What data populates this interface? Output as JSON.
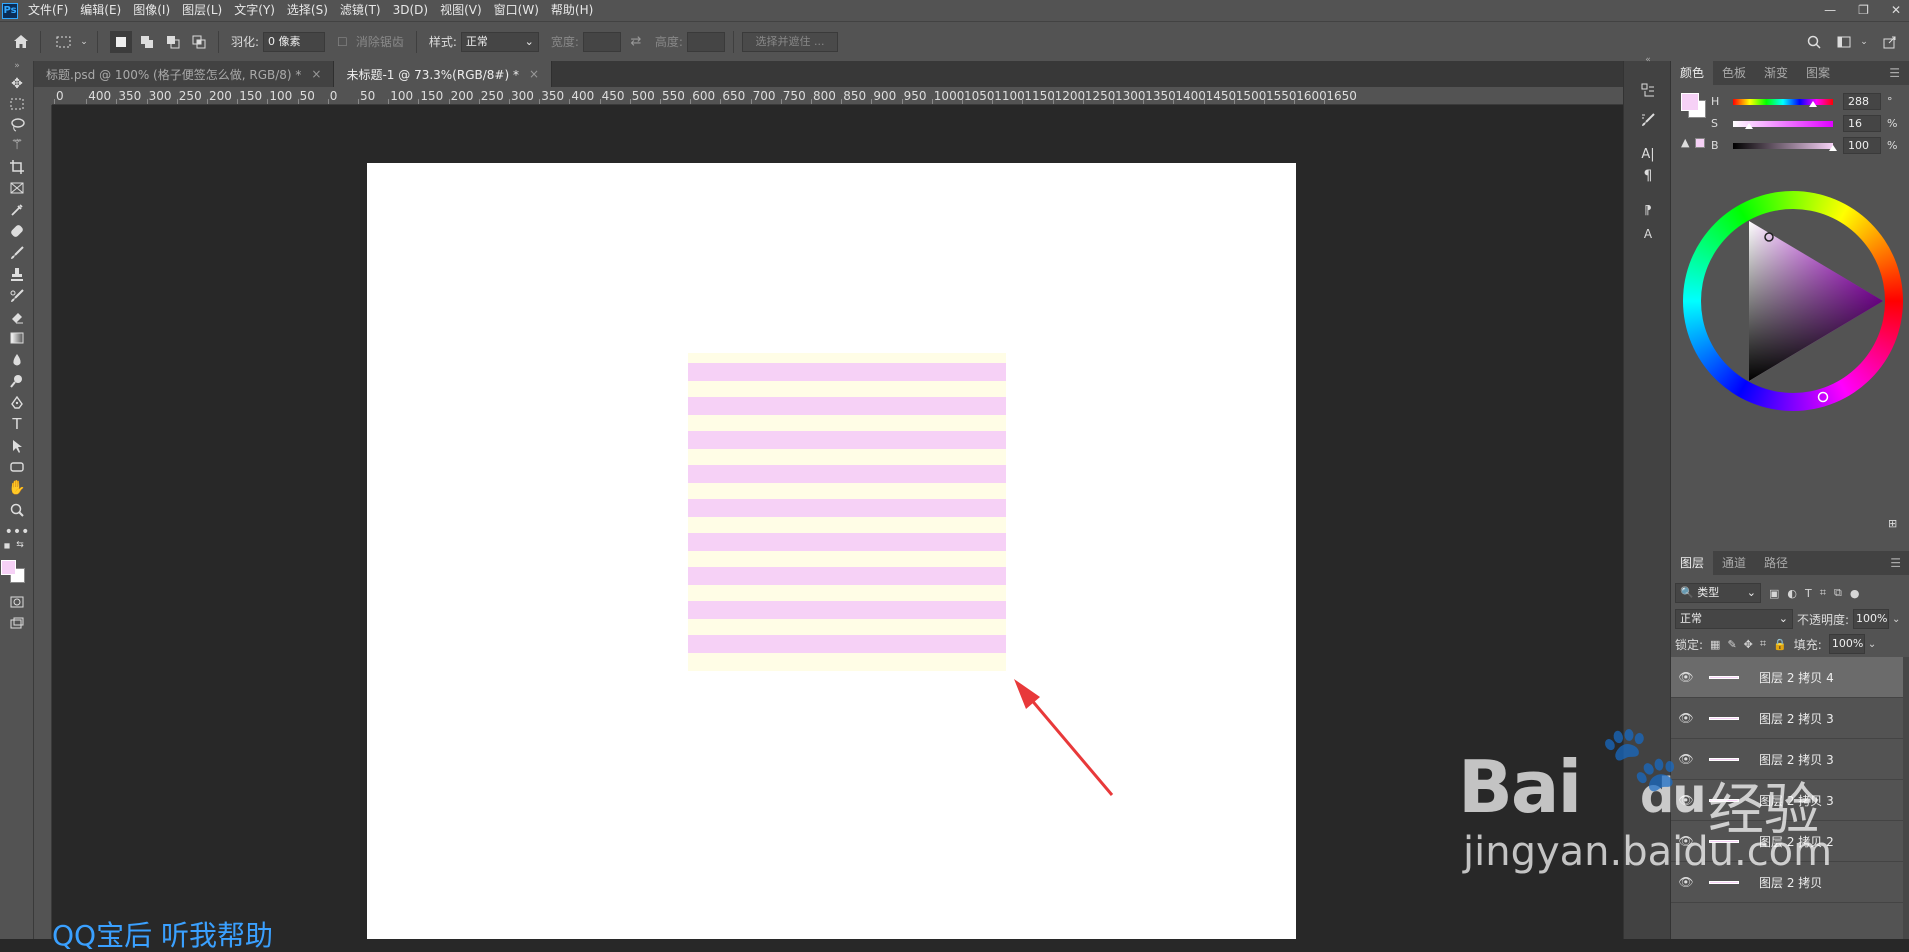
{
  "app": {
    "logo": "Ps"
  },
  "menu": [
    "文件(F)",
    "编辑(E)",
    "图像(I)",
    "图层(L)",
    "文字(Y)",
    "选择(S)",
    "滤镜(T)",
    "3D(D)",
    "视图(V)",
    "窗口(W)",
    "帮助(H)"
  ],
  "window_controls": {
    "minimize": "—",
    "restore": "❐",
    "close": "✕"
  },
  "options": {
    "feather_label": "羽化:",
    "feather_value": "0 像素",
    "antialias_label": "消除锯齿",
    "style_label": "样式:",
    "style_value": "正常",
    "width_label": "宽度:",
    "height_label": "高度:",
    "select_mask_label": "选择并遮住 ..."
  },
  "tabs": [
    {
      "label": "标题.psd @ 100% (格子便签怎么做, RGB/8) *",
      "close": "×"
    },
    {
      "label": "未标题-1 @ 73.3%(RGB/8#) *",
      "close": "×"
    }
  ],
  "ruler_top": [
    "0",
    "400",
    "350",
    "300",
    "250",
    "200",
    "150",
    "100",
    "50",
    "0",
    "50",
    "100",
    "150",
    "200",
    "250",
    "300",
    "350",
    "400",
    "450",
    "500",
    "550",
    "600",
    "650",
    "700",
    "750",
    "800",
    "850",
    "900",
    "950",
    "1000",
    "1050",
    "1100",
    "1150",
    "1200",
    "1250",
    "1300",
    "1350",
    "1400",
    "1450",
    "1500",
    "1550",
    "1600",
    "1650"
  ],
  "color_panel": {
    "tabs": [
      "颜色",
      "色板",
      "渐变",
      "图案"
    ],
    "h_label": "H",
    "h_value": "288",
    "h_unit": "°",
    "s_label": "S",
    "s_value": "16",
    "s_unit": "%",
    "b_label": "B",
    "b_value": "100",
    "b_unit": "%",
    "h_level": 0.8,
    "s_level": 0.16,
    "b_level": 1.0,
    "foreground": "#f6d1f6"
  },
  "layers_panel": {
    "tabs": [
      "图层",
      "通道",
      "路径"
    ],
    "filter_label": "类型",
    "blend_mode": "正常",
    "opacity_label": "不透明度:",
    "opacity_value": "100%",
    "lock_label": "锁定:",
    "fill_label": "填充:",
    "fill_value": "100%",
    "layers": [
      {
        "name": "图层 2 拷贝 4",
        "selected": true
      },
      {
        "name": "图层 2 拷贝 3",
        "selected": false
      },
      {
        "name": "图层 2 拷贝 3",
        "selected": false
      },
      {
        "name": "图层 2 拷贝 3",
        "selected": false
      },
      {
        "name": "图层 2 拷贝 2",
        "selected": false
      },
      {
        "name": "图层 2 拷贝",
        "selected": false
      }
    ]
  },
  "canvas": {
    "stripe_color": "#f6d1f6",
    "background_color": "#fffde6",
    "arrow_color": "#e8393a"
  },
  "watermark": {
    "brand": "Bai",
    "brand2": "du",
    "cn": "经验",
    "url": "jingyan.baidu.com"
  },
  "caption": "QQ宝后 听我帮助"
}
